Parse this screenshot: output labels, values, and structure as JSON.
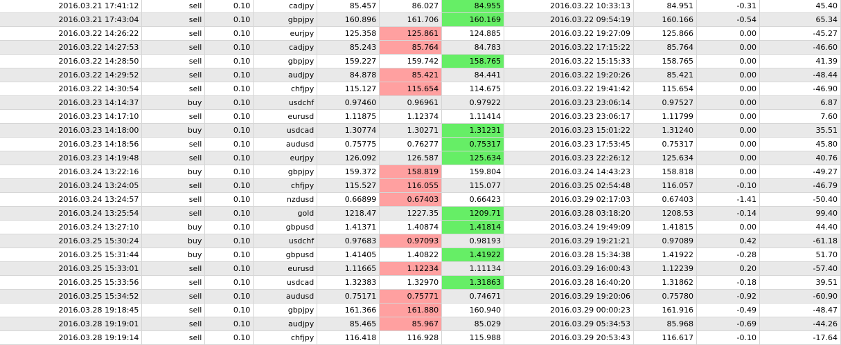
{
  "colors": {
    "row_alt_bg": "#e9e9e9",
    "grid_line": "#d6d6d6",
    "stop_loss_highlight": "#ffa0a0",
    "take_profit_highlight": "#66ee66"
  },
  "trades": [
    {
      "open_time": "2016.03.21 17:41:12",
      "type": "sell",
      "size": "0.10",
      "symbol": "cadjpy",
      "open_price": "85.457",
      "sl": "86.027",
      "tp": "84.955",
      "close_time": "2016.03.22 10:33:13",
      "close_price": "84.951",
      "swap": "-0.31",
      "profit": "45.40",
      "hit": "tp"
    },
    {
      "open_time": "2016.03.21 17:43:04",
      "type": "sell",
      "size": "0.10",
      "symbol": "gbpjpy",
      "open_price": "160.896",
      "sl": "161.706",
      "tp": "160.169",
      "close_time": "2016.03.22 09:54:19",
      "close_price": "160.166",
      "swap": "-0.54",
      "profit": "65.34",
      "hit": "tp"
    },
    {
      "open_time": "2016.03.22 14:26:22",
      "type": "sell",
      "size": "0.10",
      "symbol": "eurjpy",
      "open_price": "125.358",
      "sl": "125.861",
      "tp": "124.885",
      "close_time": "2016.03.22 19:27:09",
      "close_price": "125.866",
      "swap": "0.00",
      "profit": "-45.27",
      "hit": "sl"
    },
    {
      "open_time": "2016.03.22 14:27:53",
      "type": "sell",
      "size": "0.10",
      "symbol": "cadjpy",
      "open_price": "85.243",
      "sl": "85.764",
      "tp": "84.783",
      "close_time": "2016.03.22 17:15:22",
      "close_price": "85.764",
      "swap": "0.00",
      "profit": "-46.60",
      "hit": "sl"
    },
    {
      "open_time": "2016.03.22 14:28:50",
      "type": "sell",
      "size": "0.10",
      "symbol": "gbpjpy",
      "open_price": "159.227",
      "sl": "159.742",
      "tp": "158.765",
      "close_time": "2016.03.22 15:15:33",
      "close_price": "158.765",
      "swap": "0.00",
      "profit": "41.39",
      "hit": "tp"
    },
    {
      "open_time": "2016.03.22 14:29:52",
      "type": "sell",
      "size": "0.10",
      "symbol": "audjpy",
      "open_price": "84.878",
      "sl": "85.421",
      "tp": "84.441",
      "close_time": "2016.03.22 19:20:26",
      "close_price": "85.421",
      "swap": "0.00",
      "profit": "-48.44",
      "hit": "sl"
    },
    {
      "open_time": "2016.03.22 14:30:54",
      "type": "sell",
      "size": "0.10",
      "symbol": "chfjpy",
      "open_price": "115.127",
      "sl": "115.654",
      "tp": "114.675",
      "close_time": "2016.03.22 19:41:42",
      "close_price": "115.654",
      "swap": "0.00",
      "profit": "-46.90",
      "hit": "sl"
    },
    {
      "open_time": "2016.03.23 14:14:37",
      "type": "buy",
      "size": "0.10",
      "symbol": "usdchf",
      "open_price": "0.97460",
      "sl": "0.96961",
      "tp": "0.97922",
      "close_time": "2016.03.23 23:06:14",
      "close_price": "0.97527",
      "swap": "0.00",
      "profit": "6.87",
      "hit": ""
    },
    {
      "open_time": "2016.03.23 14:17:10",
      "type": "sell",
      "size": "0.10",
      "symbol": "eurusd",
      "open_price": "1.11875",
      "sl": "1.12374",
      "tp": "1.11414",
      "close_time": "2016.03.23 23:06:17",
      "close_price": "1.11799",
      "swap": "0.00",
      "profit": "7.60",
      "hit": ""
    },
    {
      "open_time": "2016.03.23 14:18:00",
      "type": "buy",
      "size": "0.10",
      "symbol": "usdcad",
      "open_price": "1.30774",
      "sl": "1.30271",
      "tp": "1.31231",
      "close_time": "2016.03.23 15:01:22",
      "close_price": "1.31240",
      "swap": "0.00",
      "profit": "35.51",
      "hit": "tp"
    },
    {
      "open_time": "2016.03.23 14:18:56",
      "type": "sell",
      "size": "0.10",
      "symbol": "audusd",
      "open_price": "0.75775",
      "sl": "0.76277",
      "tp": "0.75317",
      "close_time": "2016.03.23 17:53:45",
      "close_price": "0.75317",
      "swap": "0.00",
      "profit": "45.80",
      "hit": "tp"
    },
    {
      "open_time": "2016.03.23 14:19:48",
      "type": "sell",
      "size": "0.10",
      "symbol": "eurjpy",
      "open_price": "126.092",
      "sl": "126.587",
      "tp": "125.634",
      "close_time": "2016.03.23 22:26:12",
      "close_price": "125.634",
      "swap": "0.00",
      "profit": "40.76",
      "hit": "tp"
    },
    {
      "open_time": "2016.03.24 13:22:16",
      "type": "buy",
      "size": "0.10",
      "symbol": "gbpjpy",
      "open_price": "159.372",
      "sl": "158.819",
      "tp": "159.804",
      "close_time": "2016.03.24 14:43:23",
      "close_price": "158.818",
      "swap": "0.00",
      "profit": "-49.27",
      "hit": "sl"
    },
    {
      "open_time": "2016.03.24 13:24:05",
      "type": "sell",
      "size": "0.10",
      "symbol": "chfjpy",
      "open_price": "115.527",
      "sl": "116.055",
      "tp": "115.077",
      "close_time": "2016.03.25 02:54:48",
      "close_price": "116.057",
      "swap": "-0.10",
      "profit": "-46.79",
      "hit": "sl"
    },
    {
      "open_time": "2016.03.24 13:24:57",
      "type": "sell",
      "size": "0.10",
      "symbol": "nzdusd",
      "open_price": "0.66899",
      "sl": "0.67403",
      "tp": "0.66423",
      "close_time": "2016.03.29 02:17:03",
      "close_price": "0.67403",
      "swap": "-1.41",
      "profit": "-50.40",
      "hit": "sl"
    },
    {
      "open_time": "2016.03.24 13:25:54",
      "type": "sell",
      "size": "0.10",
      "symbol": "gold",
      "open_price": "1218.47",
      "sl": "1227.35",
      "tp": "1209.71",
      "close_time": "2016.03.28 03:18:20",
      "close_price": "1208.53",
      "swap": "-0.14",
      "profit": "99.40",
      "hit": "tp"
    },
    {
      "open_time": "2016.03.24 13:27:10",
      "type": "buy",
      "size": "0.10",
      "symbol": "gbpusd",
      "open_price": "1.41371",
      "sl": "1.40874",
      "tp": "1.41814",
      "close_time": "2016.03.24 19:49:09",
      "close_price": "1.41815",
      "swap": "0.00",
      "profit": "44.40",
      "hit": "tp"
    },
    {
      "open_time": "2016.03.25 15:30:24",
      "type": "buy",
      "size": "0.10",
      "symbol": "usdchf",
      "open_price": "0.97683",
      "sl": "0.97093",
      "tp": "0.98193",
      "close_time": "2016.03.29 19:21:21",
      "close_price": "0.97089",
      "swap": "0.42",
      "profit": "-61.18",
      "hit": "sl"
    },
    {
      "open_time": "2016.03.25 15:31:44",
      "type": "buy",
      "size": "0.10",
      "symbol": "gbpusd",
      "open_price": "1.41405",
      "sl": "1.40822",
      "tp": "1.41922",
      "close_time": "2016.03.28 15:34:38",
      "close_price": "1.41922",
      "swap": "-0.28",
      "profit": "51.70",
      "hit": "tp"
    },
    {
      "open_time": "2016.03.25 15:33:01",
      "type": "sell",
      "size": "0.10",
      "symbol": "eurusd",
      "open_price": "1.11665",
      "sl": "1.12234",
      "tp": "1.11134",
      "close_time": "2016.03.29 16:00:43",
      "close_price": "1.12239",
      "swap": "0.20",
      "profit": "-57.40",
      "hit": "sl"
    },
    {
      "open_time": "2016.03.25 15:33:56",
      "type": "sell",
      "size": "0.10",
      "symbol": "usdcad",
      "open_price": "1.32383",
      "sl": "1.32970",
      "tp": "1.31863",
      "close_time": "2016.03.28 16:40:20",
      "close_price": "1.31862",
      "swap": "-0.18",
      "profit": "39.51",
      "hit": "tp"
    },
    {
      "open_time": "2016.03.25 15:34:52",
      "type": "sell",
      "size": "0.10",
      "symbol": "audusd",
      "open_price": "0.75171",
      "sl": "0.75771",
      "tp": "0.74671",
      "close_time": "2016.03.29 19:20:06",
      "close_price": "0.75780",
      "swap": "-0.92",
      "profit": "-60.90",
      "hit": "sl"
    },
    {
      "open_time": "2016.03.28 19:18:45",
      "type": "sell",
      "size": "0.10",
      "symbol": "gbpjpy",
      "open_price": "161.366",
      "sl": "161.880",
      "tp": "160.940",
      "close_time": "2016.03.29 00:00:23",
      "close_price": "161.916",
      "swap": "-0.49",
      "profit": "-48.47",
      "hit": "sl"
    },
    {
      "open_time": "2016.03.28 19:19:01",
      "type": "sell",
      "size": "0.10",
      "symbol": "audjpy",
      "open_price": "85.465",
      "sl": "85.967",
      "tp": "85.029",
      "close_time": "2016.03.29 05:34:53",
      "close_price": "85.968",
      "swap": "-0.69",
      "profit": "-44.26",
      "hit": "sl"
    },
    {
      "open_time": "2016.03.28 19:19:14",
      "type": "sell",
      "size": "0.10",
      "symbol": "chfjpy",
      "open_price": "116.418",
      "sl": "116.928",
      "tp": "115.988",
      "close_time": "2016.03.29 20:53:43",
      "close_price": "116.617",
      "swap": "-0.10",
      "profit": "-17.64",
      "hit": ""
    }
  ]
}
